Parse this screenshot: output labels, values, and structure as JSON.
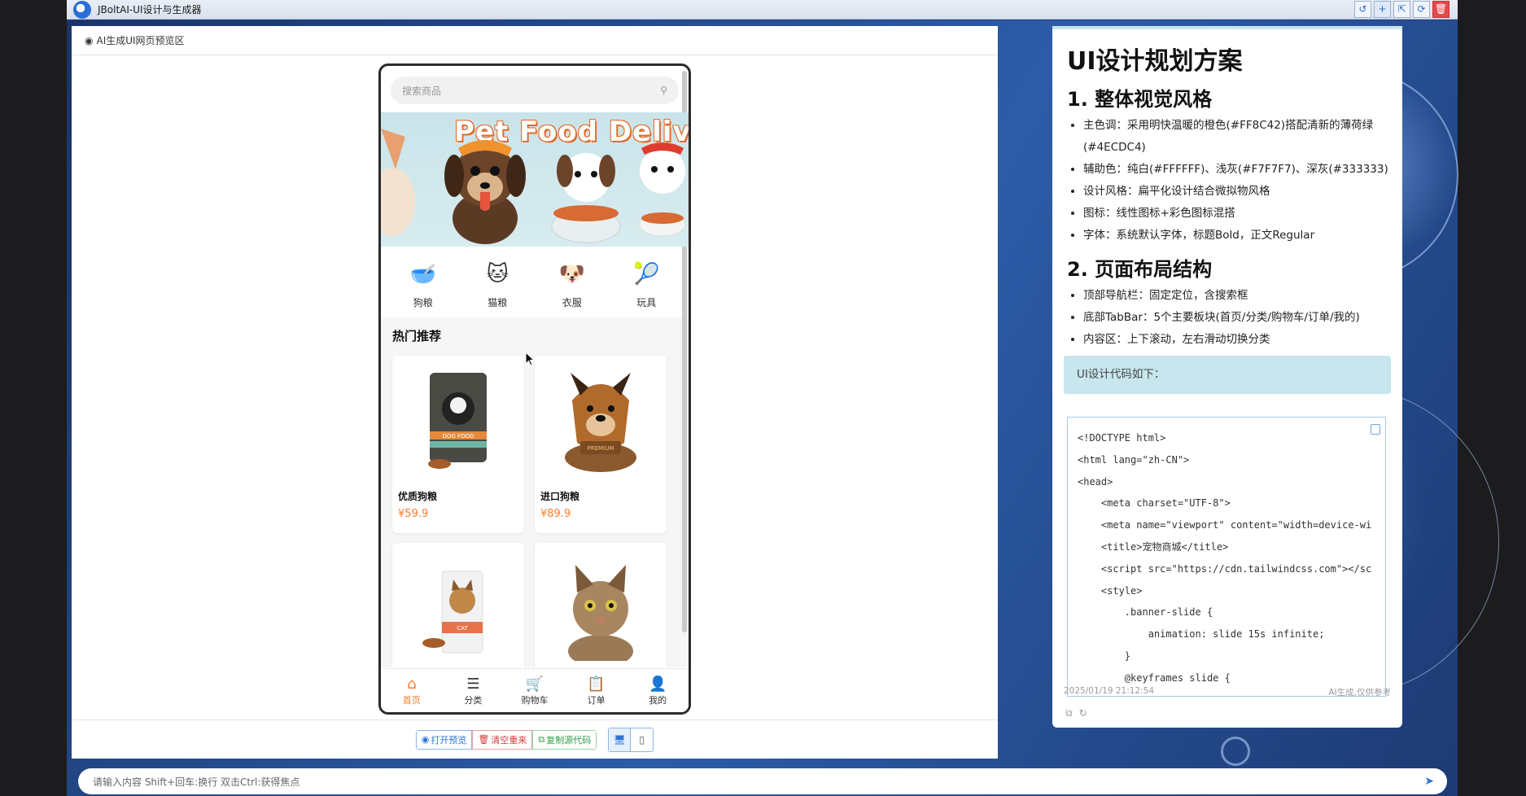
{
  "window": {
    "title": "JBoltAI-UI设计与生成器",
    "controls": [
      "↺",
      "+",
      "⇱",
      "⟳",
      "🗑"
    ]
  },
  "preview": {
    "header": "AI生成UI网页预览区",
    "phone": {
      "search_placeholder": "搜索商品",
      "banner_text": "Pet Food Delive",
      "categories": [
        {
          "label": "狗粮",
          "icon": "🥣"
        },
        {
          "label": "猫粮",
          "icon": "🐱"
        },
        {
          "label": "衣服",
          "icon": "🐶"
        },
        {
          "label": "玩具",
          "icon": "🎾"
        }
      ],
      "hot_title": "热门推荐",
      "products": [
        {
          "name": "优质狗粮",
          "price": "¥59.9",
          "img_text": "DOG FOOD"
        },
        {
          "name": "进口狗粮",
          "price": "¥89.9",
          "img_text": "PREMIUM"
        },
        {
          "name": "",
          "price": "",
          "img_text": "CAT"
        },
        {
          "name": "",
          "price": "",
          "img_text": ""
        }
      ],
      "tabs": [
        {
          "label": "首页",
          "icon": "⌂"
        },
        {
          "label": "分类",
          "icon": "☰"
        },
        {
          "label": "购物车",
          "icon": "🛒"
        },
        {
          "label": "订单",
          "icon": "📋"
        },
        {
          "label": "我的",
          "icon": "👤"
        }
      ]
    },
    "footer": {
      "open_label": "打开预览",
      "clear_label": "清空重来",
      "copy_label": "复制源代码"
    }
  },
  "plan": {
    "title": "UI设计规划方案",
    "section1": "1. 整体视觉风格",
    "section1_items": [
      "主色调：采用明快温暖的橙色(#FF8C42)搭配清新的薄荷绿",
      "(#4ECDC4)",
      "辅助色：纯白(#FFFFFF)、浅灰(#F7F7F7)、深灰(#333333)",
      "设计风格：扁平化设计结合微拟物风格",
      "图标：线性图标+彩色图标混搭",
      "字体：系统默认字体，标题Bold，正文Regular"
    ],
    "section2": "2. 页面布局结构",
    "section2_items": [
      "顶部导航栏：固定定位，含搜索框",
      "底部TabBar：5个主要板块(首页/分类/购物车/订单/我的)",
      "内容区：上下滚动，左右滑动切换分类"
    ],
    "note": "UI设计代码如下：",
    "code": [
      "<!DOCTYPE html>",
      "<html lang=\"zh-CN\">",
      "<head>",
      "    <meta charset=\"UTF-8\">",
      "    <meta name=\"viewport\" content=\"width=device-wi",
      "    <title>宠物商城</title>",
      "    <script src=\"https://cdn.tailwindcss.com\"></sc",
      "    <style>",
      "        .banner-slide {",
      "            animation: slide 15s infinite;",
      "        }",
      "        @keyframes slide {"
    ],
    "timestamp": "2025/01/19 21:12:54",
    "disclaimer": "AI生成,仅供参考"
  },
  "input": {
    "placeholder": "请输入内容 Shift+回车:换行 双击Ctrl:获得焦点"
  },
  "colors": {
    "accent_orange": "#ff7a2a",
    "primary_blue": "#2a73d6",
    "note_bg": "#c7e6ee"
  }
}
